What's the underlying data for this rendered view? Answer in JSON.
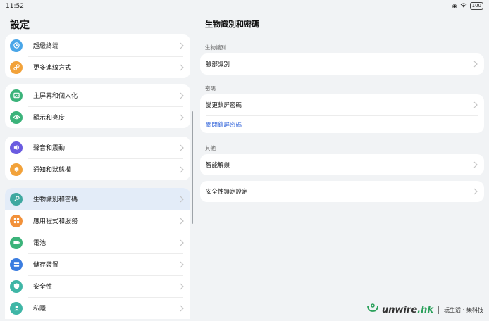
{
  "status_bar": {
    "time": "11:52",
    "battery": "100"
  },
  "left_panel": {
    "title": "設定",
    "groups": [
      {
        "items": [
          {
            "label": "超級終端",
            "icon": "super-device-icon",
            "color": "#4aa6e8"
          },
          {
            "label": "更多連線方式",
            "icon": "link-icon",
            "color": "#f2a23a"
          }
        ]
      },
      {
        "items": [
          {
            "label": "主屏幕和個人化",
            "icon": "image-icon",
            "color": "#3bb37a"
          },
          {
            "label": "顯示和亮度",
            "icon": "eye-icon",
            "color": "#3bb37a"
          }
        ]
      },
      {
        "items": [
          {
            "label": "聲音和震動",
            "icon": "speaker-icon",
            "color": "#6a5be0"
          },
          {
            "label": "通知和狀態欄",
            "icon": "bell-icon",
            "color": "#f2a23a"
          }
        ]
      },
      {
        "items": [
          {
            "label": "生物識別和密碼",
            "icon": "key-icon",
            "color": "#3fa8a0",
            "active": true
          },
          {
            "label": "應用程式和服務",
            "icon": "apps-icon",
            "color": "#f2913a"
          },
          {
            "label": "電池",
            "icon": "battery-icon",
            "color": "#3bb37a"
          },
          {
            "label": "儲存裝置",
            "icon": "storage-icon",
            "color": "#3b7de0"
          },
          {
            "label": "安全性",
            "icon": "shield-icon",
            "color": "#3fb6a6"
          },
          {
            "label": "私隱",
            "icon": "privacy-icon",
            "color": "#3fb6a6"
          }
        ]
      }
    ]
  },
  "right_panel": {
    "title": "生物識別和密碼",
    "sections": [
      {
        "label": "生物識別",
        "rows": [
          {
            "label": "臉部識別"
          }
        ]
      },
      {
        "label": "密碼",
        "rows": [
          {
            "label": "變更鎖屏密碼"
          },
          {
            "label": "關閉鎖屏密碼",
            "link": true
          }
        ]
      },
      {
        "label": "其他",
        "rows": [
          {
            "label": "智能解鎖"
          }
        ]
      },
      {
        "label": "",
        "rows": [
          {
            "label": "安全性鎖定設定"
          }
        ]
      }
    ]
  },
  "watermark": {
    "logo_main": "unwire",
    "logo_suffix": ".hk",
    "tagline": "玩生活・樂科技"
  },
  "colors": {
    "accent": "#2b5fd9",
    "active_bg": "#e3ecf8",
    "background": "#f1f3f5"
  }
}
